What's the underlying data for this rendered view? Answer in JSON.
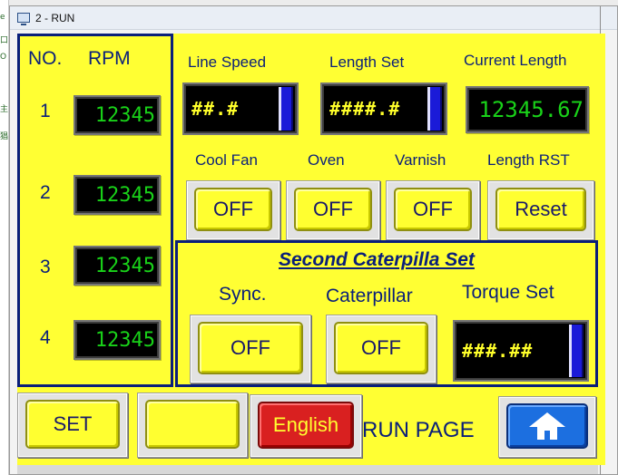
{
  "window": {
    "title": "2 - RUN"
  },
  "desktop_strip": [
    "e",
    "口",
    "O",
    "主",
    "猖"
  ],
  "rpm_section": {
    "header_no": "NO.",
    "header_rpm": "RPM",
    "rows": [
      {
        "no": "1",
        "value": "12345"
      },
      {
        "no": "2",
        "value": "12345"
      },
      {
        "no": "3",
        "value": "12345"
      },
      {
        "no": "4",
        "value": "12345"
      }
    ]
  },
  "top_section": {
    "line_speed_label": "Line Speed",
    "line_speed_value": "##.#",
    "length_set_label": "Length Set",
    "length_set_value": "####.#",
    "current_length_label": "Current Length",
    "current_length_value": "12345.67",
    "cool_fan_label": "Cool Fan",
    "cool_fan_button": "OFF",
    "oven_label": "Oven",
    "oven_button": "OFF",
    "varnish_label": "Varnish",
    "varnish_button": "OFF",
    "length_rst_label": "Length RST",
    "length_rst_button": "Reset"
  },
  "caterpilla_section": {
    "title": "Second Caterpilla Set",
    "sync_label": "Sync.",
    "sync_button": "OFF",
    "caterpillar_label": "Caterpillar",
    "caterpillar_button": "OFF",
    "torque_label": "Torque Set",
    "torque_value": "###.##"
  },
  "bottom_bar": {
    "set_button": "SET",
    "blank_button": "",
    "english_button": "English",
    "page_label": "RUN PAGE",
    "home_icon": "home-icon"
  },
  "colors": {
    "panel_bg": "#ffff33",
    "frame": "#0a1f7a",
    "display_text": "#19d219",
    "input_text": "#ffff2a",
    "english_button": "#d92020",
    "home_button": "#1c6fe0"
  }
}
